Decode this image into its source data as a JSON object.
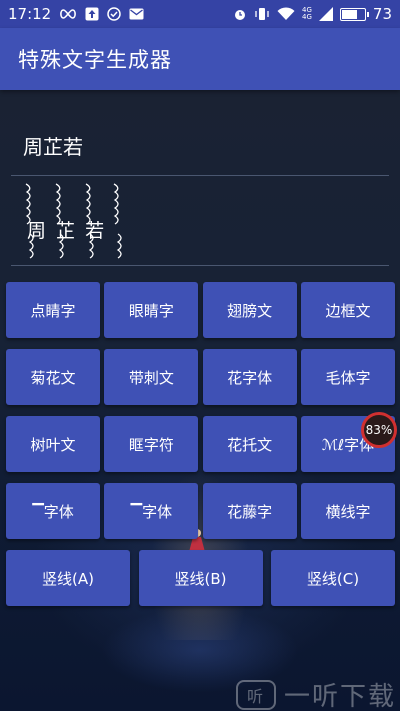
{
  "status_bar": {
    "time": "17:12",
    "battery": "73",
    "battery_level": 0.73,
    "network": "4G",
    "icons": [
      "infinity-icon",
      "upload-icon",
      "check-circle-icon",
      "mail-icon",
      "alarm-icon",
      "vibrate-icon",
      "wifi-icon",
      "signal-icon",
      "battery-icon"
    ]
  },
  "app_bar": {
    "title": "特殊文字生成器"
  },
  "input": {
    "value": "周芷若"
  },
  "output": {
    "text": "周 芷 若"
  },
  "buttons": {
    "row1": [
      "点睛字",
      "眼睛字",
      "翅膀文",
      "边框文"
    ],
    "row2": [
      "菊花文",
      "带刺文",
      "花字体",
      "毛体字"
    ],
    "row3": [
      "树叶文",
      "眶字符",
      "花托文",
      "ℳℓ字体"
    ],
    "row4": [
      "▔字体",
      "▔字体",
      "花藤字",
      "横线字"
    ],
    "row5": [
      "竖线(A)",
      "竖线(B)",
      "竖线(C)"
    ]
  },
  "badge": {
    "text": "83%"
  },
  "watermark": {
    "text": "一听下载",
    "logo": "听"
  },
  "colors": {
    "primary": "#3f51b5",
    "status_bar": "#3543a5",
    "background": "#0e1930"
  }
}
